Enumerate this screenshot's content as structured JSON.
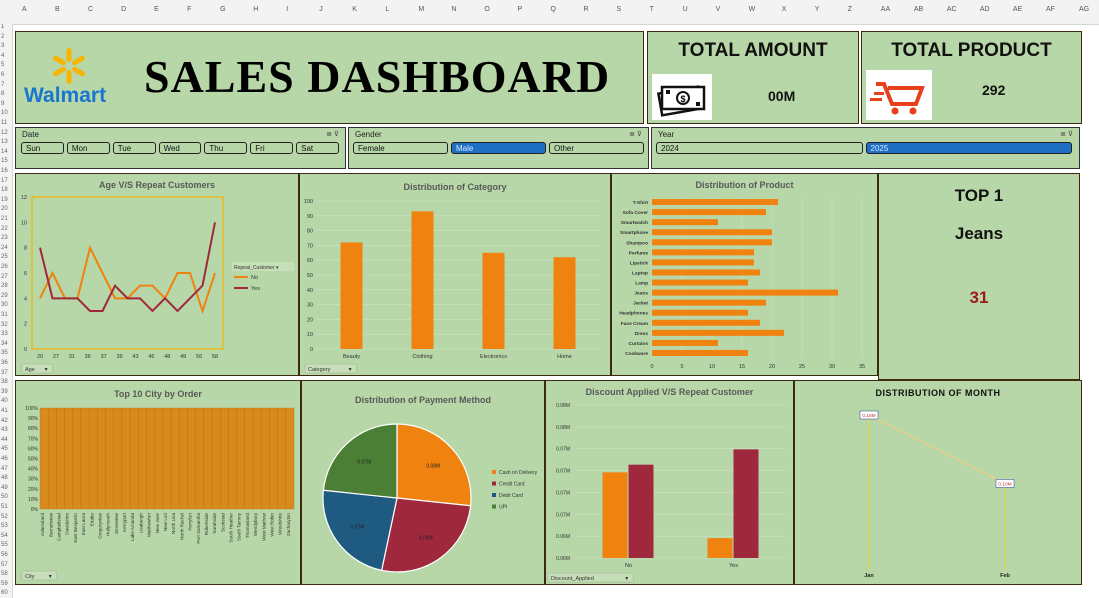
{
  "header": {
    "brand": "Walmart",
    "title": "SALES DASHBOARD",
    "brand_color": "#1a75cf",
    "spark_color": "#f8b400"
  },
  "kpis": {
    "amount_label": "TOTAL AMOUNT",
    "amount_value": "00M",
    "product_label": "TOTAL PRODUCT",
    "product_value": "292"
  },
  "slicers": {
    "date": {
      "label": "Date",
      "items": [
        "Sun",
        "Mon",
        "Tue",
        "Wed",
        "Thu",
        "Fri",
        "Sat"
      ]
    },
    "gender": {
      "label": "Gender",
      "items": [
        "Female",
        "Male",
        "Other"
      ],
      "selected": "Male"
    },
    "year": {
      "label": "Year",
      "items": [
        "2024",
        "2025"
      ],
      "selected": "2025"
    }
  },
  "top": {
    "title": "TOP 1",
    "name": "Jeans",
    "value": "31"
  },
  "column_letters": [
    "A",
    "B",
    "C",
    "D",
    "E",
    "F",
    "G",
    "H",
    "I",
    "J",
    "K",
    "L",
    "M",
    "N",
    "O",
    "P",
    "Q",
    "R",
    "S",
    "T",
    "U",
    "V",
    "W",
    "X",
    "Y",
    "Z",
    "AA",
    "AB",
    "AC",
    "AD",
    "AE",
    "AF",
    "AG"
  ],
  "chart_data": [
    {
      "id": "age",
      "type": "line",
      "title": "Age V/S Repeat Customers",
      "x": [
        "20",
        "27",
        "31",
        "36",
        "37",
        "39",
        "43",
        "46",
        "48",
        "49",
        "56",
        "58"
      ],
      "ylim": [
        0,
        12
      ],
      "yticks": [
        "0",
        "2",
        "4",
        "6",
        "8",
        "10",
        "12"
      ],
      "legend_title": "Repeat_Customer",
      "filter_label": "Age",
      "series": [
        {
          "name": "No",
          "color": "#f0820f",
          "values": [
            4,
            6,
            4,
            4,
            8,
            6,
            4,
            4,
            5,
            5,
            4,
            6,
            6,
            3,
            6
          ]
        },
        {
          "name": "Yes",
          "color": "#a0283c",
          "values": [
            8,
            4,
            4,
            4,
            3,
            3,
            5,
            4,
            4,
            3,
            4,
            3,
            4,
            5,
            10
          ]
        }
      ]
    },
    {
      "id": "category",
      "type": "bar",
      "title": "Distribution of Category",
      "categories": [
        "Beauty",
        "Clothing",
        "Electronics",
        "Home"
      ],
      "values": [
        72,
        93,
        65,
        62
      ],
      "ylim": [
        0,
        100
      ],
      "yticks": [
        "0",
        "10",
        "20",
        "30",
        "40",
        "50",
        "60",
        "70",
        "80",
        "90",
        "100"
      ],
      "filter_label": "Category",
      "color": "#f0820f"
    },
    {
      "id": "product",
      "type": "bar",
      "orientation": "horizontal",
      "title": "Distribution of Product",
      "categories": [
        "T-Shirt",
        "Sofa Cover",
        "Smartwatch",
        "Smartphone",
        "Shampoo",
        "Perfume",
        "Lipstick",
        "Laptop",
        "Lamp",
        "Jeans",
        "Jacket",
        "Headphones",
        "Face Cream",
        "Dress",
        "Curtains",
        "Cookware"
      ],
      "values": [
        21,
        19,
        11,
        20,
        20,
        17,
        17,
        18,
        16,
        31,
        19,
        16,
        18,
        22,
        11,
        16
      ],
      "xlim": [
        0,
        35
      ],
      "xticks": [
        "0",
        "5",
        "10",
        "15",
        "20",
        "25",
        "30",
        "35"
      ],
      "color": "#f0820f"
    },
    {
      "id": "city",
      "type": "bar",
      "title": "Top 10 City by Order",
      "categories": [
        "Adamsland",
        "Barnettview",
        "Campbellstad",
        "Davidshire",
        "East Benjamin",
        "East Laura",
        "Eriabo",
        "Gregoryview",
        "Hollymouth",
        "Jonesview",
        "Kerryport",
        "Lake Amanda",
        "Lisaburgh",
        "Matthewfort",
        "New Jose",
        "New Lori",
        "North Lisa",
        "North Rachel",
        "Perryfurt",
        "Port Samantha",
        "Robertside",
        "Sarahside",
        "Scottstad",
        "South Heather",
        "South Tammy",
        "Thomasland",
        "Wendybury",
        "West Mathew",
        "West Robin",
        "Woodshire",
        "Zacharyton"
      ],
      "values": [
        100,
        100,
        100,
        100,
        100,
        100,
        100,
        100,
        100,
        100,
        100,
        100,
        100,
        100,
        100,
        100,
        100,
        100,
        100,
        100,
        100,
        100,
        100,
        100,
        100,
        100,
        100,
        100,
        100,
        100,
        100
      ],
      "ylim": [
        0,
        100
      ],
      "yticks": [
        "0%",
        "10%",
        "20%",
        "30%",
        "40%",
        "50%",
        "60%",
        "70%",
        "80%",
        "90%",
        "100%"
      ],
      "filter_label": "City",
      "color": "#d88a1c"
    },
    {
      "id": "payment",
      "type": "pie",
      "title": "Distribution of Payment Method",
      "labels": [
        "Cash on Delivery",
        "Credit Card",
        "Debit Card",
        "UPI"
      ],
      "values": [
        0.08,
        0.08,
        0.07,
        0.07
      ],
      "value_labels": [
        "0.08M",
        "0.08M",
        "0.07M",
        "0.07M"
      ],
      "colors": [
        "#f0820f",
        "#a0283c",
        "#1f5a80",
        "#4a7f35"
      ]
    },
    {
      "id": "discount",
      "type": "bar",
      "title": "Discount Applied V/S Repeat Customer",
      "categories": [
        "No",
        "Yes"
      ],
      "ylim": [
        0.06,
        0.08
      ],
      "yticks": [
        "0.06M",
        "0.06M",
        "0.07M",
        "0.07M",
        "0.07M",
        "0.07M",
        "0.08M",
        "0.08M"
      ],
      "filter_label": "Discount_Applied",
      "series": [
        {
          "name": "No",
          "color": "#f0820f",
          "values": [
            0.0712,
            0.0626
          ]
        },
        {
          "name": "Yes",
          "color": "#a0283c",
          "values": [
            0.0722,
            0.0742
          ]
        }
      ]
    },
    {
      "id": "month",
      "type": "line",
      "title": "DISTRIBUTION OF MONTH",
      "categories": [
        "Jan",
        "Feb"
      ],
      "values": [
        0.18,
        0.1
      ],
      "value_labels": [
        "0.18M",
        "0.10M"
      ],
      "line_color": "#f3c98b",
      "drop_color": "#f2d027"
    }
  ]
}
